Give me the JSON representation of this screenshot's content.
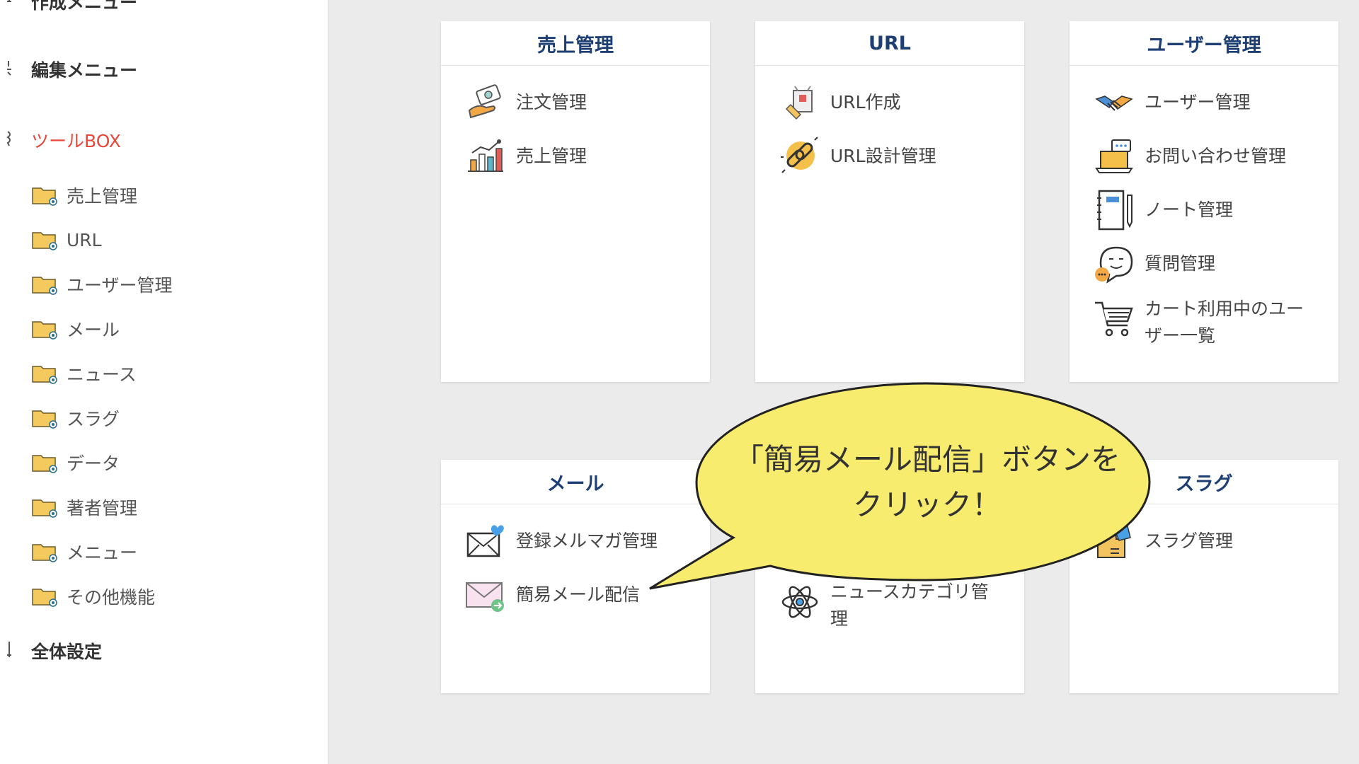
{
  "sidebar": {
    "sections": {
      "create_menu": "作成メニュー",
      "edit_menu": "編集メニュー",
      "toolbox": "ツールBOX",
      "global_settings": "全体設定"
    },
    "items": [
      {
        "label": "売上管理"
      },
      {
        "label": "URL"
      },
      {
        "label": "ユーザー管理"
      },
      {
        "label": "メール"
      },
      {
        "label": "ニュース"
      },
      {
        "label": "スラグ"
      },
      {
        "label": "データ"
      },
      {
        "label": "著者管理"
      },
      {
        "label": "メニュー"
      },
      {
        "label": "その他機能"
      }
    ]
  },
  "cards": {
    "sales": {
      "title": "売上管理",
      "items": [
        {
          "label": "注文管理",
          "icon": "order-hand-icon"
        },
        {
          "label": "売上管理",
          "icon": "sales-chart-icon"
        }
      ]
    },
    "url": {
      "title": "URL",
      "items": [
        {
          "label": "URL作成",
          "icon": "url-create-icon"
        },
        {
          "label": "URL設計管理",
          "icon": "link-chain-icon"
        }
      ]
    },
    "user": {
      "title": "ユーザー管理",
      "items": [
        {
          "label": "ユーザー管理",
          "icon": "handshake-icon"
        },
        {
          "label": "お問い合わせ管理",
          "icon": "inquiry-laptop-icon"
        },
        {
          "label": "ノート管理",
          "icon": "notebook-icon"
        },
        {
          "label": "質問管理",
          "icon": "question-chat-icon"
        },
        {
          "label": "カート利用中のユーザー一覧",
          "icon": "cart-icon"
        }
      ]
    },
    "mail": {
      "title": "メール",
      "items": [
        {
          "label": "登録メルマガ管理",
          "icon": "mail-heart-icon"
        },
        {
          "label": "簡易メール配信",
          "icon": "mail-send-icon"
        }
      ]
    },
    "news": {
      "items": [
        {
          "label": "ニュースカテゴリ管理",
          "icon": "atom-icon"
        }
      ]
    },
    "slug": {
      "title": "スラグ",
      "items": [
        {
          "label": "スラグ管理",
          "icon": "puzzle-icon"
        }
      ]
    }
  },
  "callout": {
    "text": "「簡易メール配信」ボタンをクリック！"
  },
  "colors": {
    "accent_red": "#e8473a",
    "card_title": "#1d3f73",
    "balloon_fill": "#f7ec6e",
    "folder_yellow": "#f4c95d"
  }
}
